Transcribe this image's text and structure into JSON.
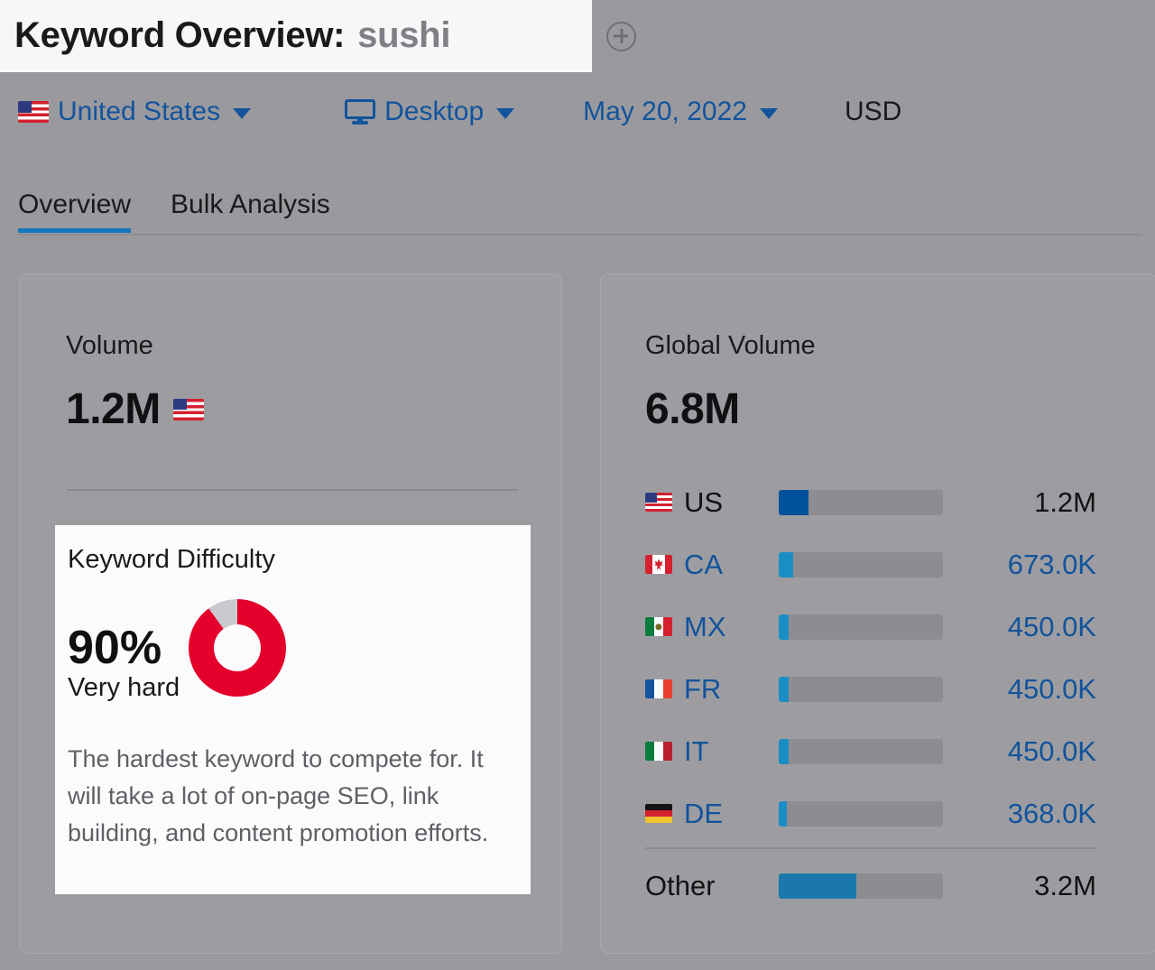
{
  "header": {
    "title_prefix": "Keyword Overview:",
    "keyword": "sushi",
    "add_icon": "plus-circle-icon",
    "filters": {
      "country": "United States",
      "country_flag": "us-flag-icon",
      "device": "Desktop",
      "device_icon": "monitor-icon",
      "date": "May 20, 2022",
      "currency": "USD"
    }
  },
  "tabs": [
    {
      "label": "Overview",
      "active": true
    },
    {
      "label": "Bulk Analysis",
      "active": false
    }
  ],
  "volume_card": {
    "title": "Volume",
    "value": "1.2M",
    "flag": "us-flag-icon"
  },
  "keyword_difficulty": {
    "title": "Keyword Difficulty",
    "score": "90%",
    "level": "Very hard",
    "description": "The hardest keyword to compete for. It will take a lot of on-page SEO, link building, and content promotion efforts.",
    "donut_color": "#e4002b",
    "donut_track_color": "#c9c9ce"
  },
  "global_volume": {
    "title": "Global Volume",
    "value": "6.8M",
    "rows": [
      {
        "code": "US",
        "flag": "us-flag-icon",
        "value": "1.2M",
        "bar_pct": 18,
        "bar_color": "#00529b",
        "link": false
      },
      {
        "code": "CA",
        "flag": "ca-flag-icon",
        "value": "673.0K",
        "bar_pct": 9,
        "bar_color": "#1a8ec4",
        "link": true
      },
      {
        "code": "MX",
        "flag": "mx-flag-icon",
        "value": "450.0K",
        "bar_pct": 6,
        "bar_color": "#1a8ec4",
        "link": true
      },
      {
        "code": "FR",
        "flag": "fr-flag-icon",
        "value": "450.0K",
        "bar_pct": 6,
        "bar_color": "#1a8ec4",
        "link": true
      },
      {
        "code": "IT",
        "flag": "it-flag-icon",
        "value": "450.0K",
        "bar_pct": 6,
        "bar_color": "#1a8ec4",
        "link": true
      },
      {
        "code": "DE",
        "flag": "de-flag-icon",
        "value": "368.0K",
        "bar_pct": 5,
        "bar_color": "#1a8ec4",
        "link": true
      },
      {
        "code": "Other",
        "flag": null,
        "value": "3.2M",
        "bar_pct": 47,
        "bar_color": "#1a78ac",
        "link": false
      }
    ]
  },
  "chart_data": {
    "type": "bar",
    "title": "Global Volume",
    "total": "6.8M",
    "categories": [
      "US",
      "CA",
      "MX",
      "FR",
      "IT",
      "DE",
      "Other"
    ],
    "values": [
      1200000,
      673000,
      450000,
      450000,
      450000,
      368000,
      3200000
    ],
    "value_labels": [
      "1.2M",
      "673.0K",
      "450.0K",
      "450.0K",
      "450.0K",
      "368.0K",
      "3.2M"
    ],
    "bar_percents": [
      18,
      9,
      6,
      6,
      6,
      5,
      47
    ],
    "xlabel": "",
    "ylabel": "",
    "legend": "none",
    "grid": false
  }
}
